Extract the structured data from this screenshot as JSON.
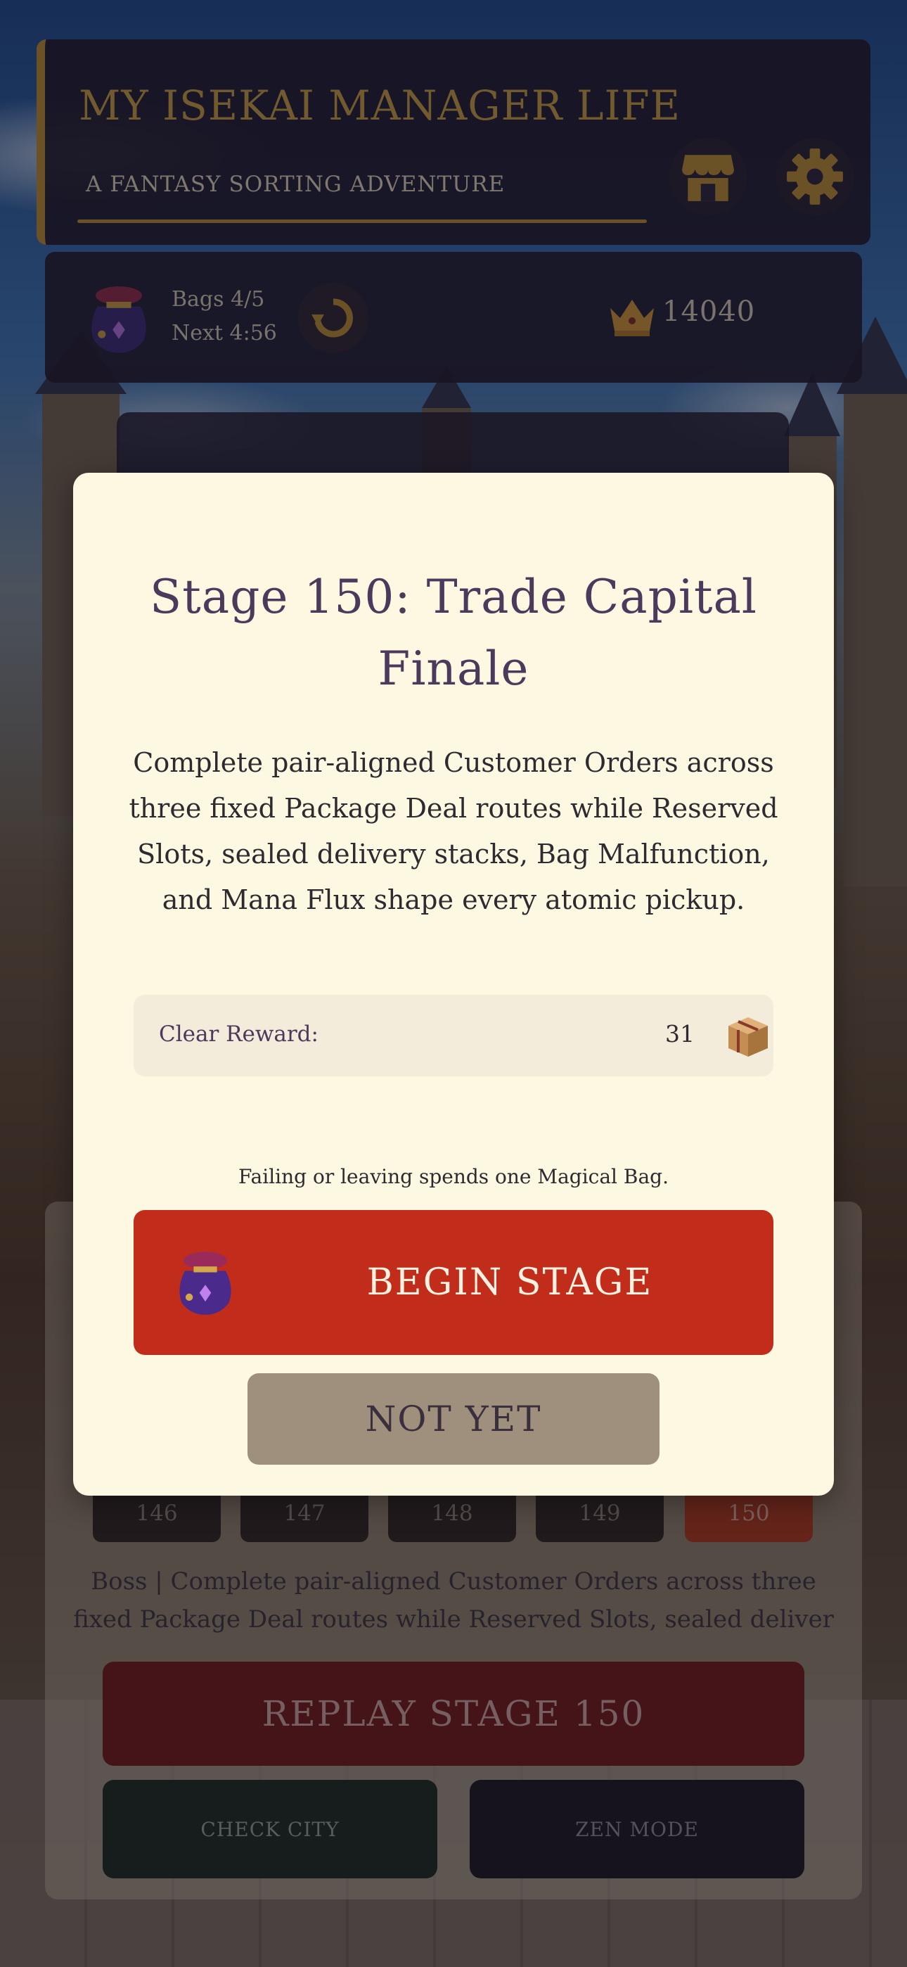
{
  "header": {
    "title": "MY ISEKAI MANAGER LIFE",
    "subtitle": "A FANTASY SORTING ADVENTURE",
    "shop_icon": "shop-icon",
    "settings_icon": "gear-icon"
  },
  "status": {
    "bags": "Bags 4/5",
    "next": "Next 4:56",
    "coins": "14040"
  },
  "stage_select": {
    "tiles": [
      "146",
      "147",
      "148",
      "149",
      "150"
    ],
    "selected": "150",
    "info_line_1": "Boss  |  Complete pair-aligned Customer Orders across three",
    "info_line_2": "fixed Package Deal routes while Reserved Slots, sealed deliver",
    "replay_label": "REPLAY STAGE 150",
    "city_label": "CHECK CITY",
    "zen_label": "ZEN MODE"
  },
  "modal": {
    "title": "Stage 150: Trade Capital Finale",
    "description": "Complete pair-aligned Customer Orders across three fixed Package Deal routes while Reserved Slots, sealed delivery stacks, Bag Malfunction, and Mana Flux shape every atomic pickup.",
    "reward_label": "Clear Reward:",
    "reward_value": "31",
    "fail_note": "Failing or leaving spends one Magical Bag.",
    "begin_label": "BEGIN STAGE",
    "cancel_label": "NOT YET"
  },
  "colors": {
    "gold": "#c29a45",
    "modal_bg": "#fdf8e2",
    "begin_red": "#c22d1b",
    "title_purple": "#4b3a5c"
  }
}
